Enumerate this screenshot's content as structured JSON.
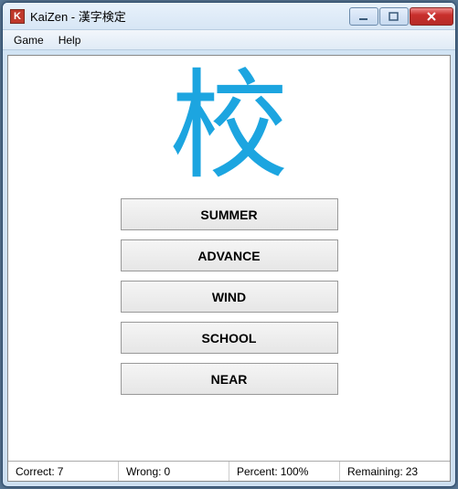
{
  "window": {
    "app_icon_letter": "K",
    "title": "KaiZen - 漢字検定"
  },
  "menu": {
    "game": "Game",
    "help": "Help"
  },
  "quiz": {
    "kanji": "校",
    "choices": [
      "SUMMER",
      "ADVANCE",
      "WIND",
      "SCHOOL",
      "NEAR"
    ]
  },
  "status": {
    "correct_label": "Correct:",
    "correct_value": "7",
    "wrong_label": "Wrong:",
    "wrong_value": "0",
    "percent_label": "Percent:",
    "percent_value": "100%",
    "remaining_label": "Remaining:",
    "remaining_value": "23"
  }
}
